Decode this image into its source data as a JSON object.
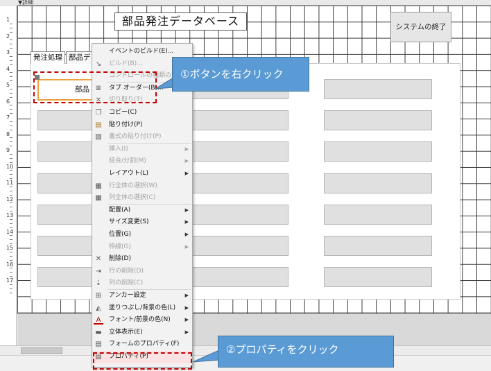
{
  "section_header": "▼詳細",
  "ruler_labels": [
    "1",
    "2",
    "3",
    "4",
    "5",
    "6",
    "7",
    "8",
    "9",
    "10",
    "11",
    "12",
    "13",
    "14",
    "15",
    "16",
    "17"
  ],
  "form": {
    "title": "部品発注データベース",
    "exit_button": "システムの終了",
    "tabs": [
      "発注処理",
      "部品デ"
    ],
    "selected_button": "部品"
  },
  "context_menu": {
    "items": [
      {
        "label": "イベントのビルド(E)...",
        "icon": "none",
        "disabled": false
      },
      {
        "label": "ビルド(B)...",
        "icon": "build-icon",
        "disabled": true
      },
      {
        "label": "コントロールの種類の変更",
        "icon": "none",
        "disabled": true
      },
      {
        "label": "タブ オーダー(B)...",
        "icon": "tab-order-icon",
        "disabled": false
      },
      {
        "label": "切り取り(T)",
        "icon": "cut-icon",
        "disabled": true
      },
      {
        "label": "コピー(C)",
        "icon": "copy-icon",
        "disabled": false
      },
      {
        "label": "貼り付け(P)",
        "icon": "paste-icon",
        "disabled": false
      },
      {
        "label": "書式の貼り付け(P)",
        "icon": "format-paste-icon",
        "disabled": true
      },
      {
        "label": "挿入(I)",
        "icon": "none",
        "disabled": true,
        "submenu": true
      },
      {
        "label": "結合/分割(M)",
        "icon": "none",
        "disabled": true,
        "submenu": true
      },
      {
        "label": "レイアウト(L)",
        "icon": "none",
        "disabled": false,
        "submenu": true
      },
      {
        "label": "行全体の選択(W)",
        "icon": "select-row-icon",
        "disabled": true
      },
      {
        "label": "列全体の選択(C)",
        "icon": "select-column-icon",
        "disabled": true
      },
      {
        "label": "配置(A)",
        "icon": "none",
        "disabled": false,
        "submenu": true
      },
      {
        "label": "サイズ変更(S)",
        "icon": "none",
        "disabled": false,
        "submenu": true
      },
      {
        "label": "位置(G)",
        "icon": "none",
        "disabled": false,
        "submenu": true
      },
      {
        "label": "枠線(G)",
        "icon": "none",
        "disabled": true,
        "submenu": true
      },
      {
        "label": "削除(D)",
        "icon": "delete-icon",
        "disabled": false
      },
      {
        "label": "行の削除(D)",
        "icon": "delete-row-icon",
        "disabled": true
      },
      {
        "label": "列の削除(C)",
        "icon": "delete-column-icon",
        "disabled": true
      },
      {
        "label": "アンカー設定",
        "icon": "anchor-icon",
        "disabled": false,
        "submenu": true
      },
      {
        "label": "塗りつぶし/背景の色(L)",
        "icon": "fill-color-icon",
        "disabled": false,
        "submenu": true
      },
      {
        "label": "フォント/前景の色(N)",
        "icon": "font-color-icon",
        "disabled": false,
        "submenu": true
      },
      {
        "label": "立体表示(E)",
        "icon": "effect-icon",
        "disabled": false,
        "submenu": true
      },
      {
        "label": "フォームのプロパティ(F)",
        "icon": "form-properties-icon",
        "disabled": false
      },
      {
        "label": "プロパティ(P)",
        "icon": "properties-icon",
        "disabled": false,
        "highlighted": true
      }
    ]
  },
  "callouts": {
    "step1": "①ボタンを右クリック",
    "step2": "②プロパティをクリック"
  },
  "colors": {
    "callout_fill": "#5b9bd5",
    "dashed_box": "#c00000",
    "selection_border": "#f0a040",
    "highlight": "#fce2e2"
  }
}
